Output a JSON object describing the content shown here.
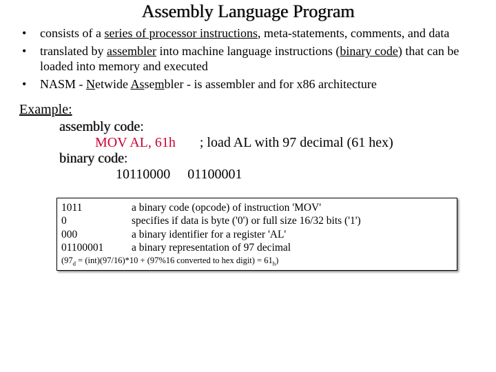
{
  "title": "Assembly Language Program",
  "bullets": {
    "b1_pre": "consists of a ",
    "b1_u": "series of processor instructions",
    "b1_post": ", meta-statements, comments, and data",
    "b2_pre": "translated by ",
    "b2_u1": "assembler",
    "b2_mid": " into machine language instructions (",
    "b2_u2": "binary code",
    "b2_post": ") that can be loaded into memory and executed",
    "b3_pre": "NASM - ",
    "b3_u1": "N",
    "b3_mid1": "etwide ",
    "b3_u2": "As",
    "b3_mid2": "se",
    "b3_u3": "m",
    "b3_post": "bler - is assembler and for x86 architecture"
  },
  "example": {
    "label": "Example:",
    "asm_label": "assembly code",
    "colon": ":",
    "asm_line_instr": "MOV AL, 61h",
    "asm_line_gap": "       ",
    "asm_line_comment": "; load AL with 97 decimal (61 hex)",
    "bin_label": "binary code",
    "bin_line_a": "10110000",
    "bin_gap": "     ",
    "bin_line_b": "01100001"
  },
  "table": {
    "r1c1": "1011",
    "r1c2": "a binary code (opcode) of instruction 'MOV'",
    "r2c1": "0",
    "r2c2": "specifies if data is byte ('0') or full size 16/32 bits ('1')",
    "r3c1": "000",
    "r3c2": "a binary identifier for a register 'AL'",
    "r4c1": "01100001",
    "r4c2": "a binary representation of 97 decimal",
    "foot_pre": "(97",
    "foot_sub1": "d",
    "foot_mid": " = (int)(97/16)*10 + (97%16 converted to hex digit) = 61",
    "foot_sub2": "h",
    "foot_post": ")"
  }
}
